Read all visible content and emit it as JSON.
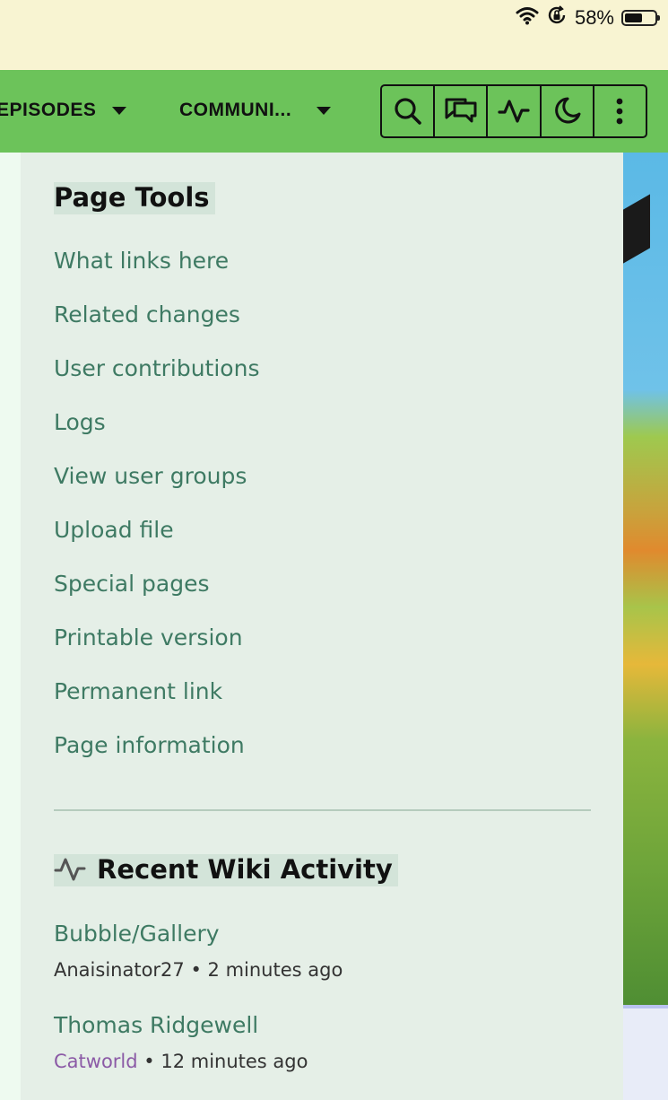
{
  "status_bar": {
    "battery_percent": "58%",
    "icons": [
      "wifi-icon",
      "orientation-lock-icon",
      "battery-icon"
    ]
  },
  "nav": {
    "menus": [
      {
        "label": "EPISODES"
      },
      {
        "label": "COMMUNI..."
      }
    ],
    "tools": [
      "search-icon",
      "discussions-icon",
      "activity-icon",
      "dark-mode-icon",
      "more-icon"
    ]
  },
  "page_tools": {
    "title": "Page Tools",
    "links": [
      "What links here",
      "Related changes",
      "User contributions",
      "Logs",
      "View user groups",
      "Upload file",
      "Special pages",
      "Printable version",
      "Permanent link",
      "Page information"
    ]
  },
  "recent_activity": {
    "title": "Recent Wiki Activity",
    "items": [
      {
        "page": "Bubble/Gallery",
        "user": "Anaisinator27",
        "separator": " • ",
        "time": "2 minutes ago"
      },
      {
        "page": "Thomas Ridgewell",
        "user": "Catworld",
        "separator": " • ",
        "time": "12 minutes ago"
      }
    ]
  },
  "colors": {
    "nav_green": "#6cc35a",
    "panel_bg": "#e5efe7",
    "link_green": "#3e7a63",
    "user_purple": "#8b5aa6"
  }
}
